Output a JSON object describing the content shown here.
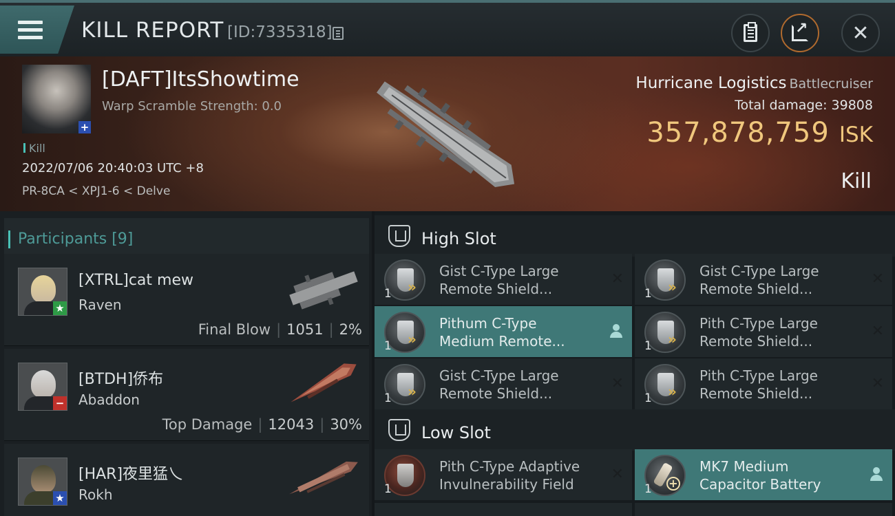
{
  "header": {
    "title": "KILL REPORT",
    "report_id": "[ID:7335318]",
    "menu_icon": "hamburger-menu-icon",
    "buttons": [
      "clipboard-icon",
      "share-icon",
      "close-icon"
    ]
  },
  "victim": {
    "name": "[DAFT]ItsShowtime",
    "warp_scramble": "Warp Scramble Strength: 0.0",
    "tag": "Kill",
    "datetime": "2022/07/06 20:40:03 UTC +8",
    "location": "PR-8CA < XPJ1-6 < Delve",
    "badge": "+"
  },
  "ship": {
    "name": "Hurricane Logistics",
    "class": "Battlecruiser",
    "total_damage_label": "Total damage:",
    "total_damage": "39808",
    "isk_value": "357,878,759",
    "isk_unit": "ISK",
    "result": "Kill"
  },
  "participants": {
    "title": "Participants [9]",
    "rows": [
      {
        "name": "[XTRL]cat mew",
        "ship": "Raven",
        "label": "Final Blow",
        "damage": "1051",
        "percent": "2%",
        "badge": "★",
        "badge_color": "#2e9a46"
      },
      {
        "name": "[BTDH]侨布",
        "ship": "Abaddon",
        "label": "Top Damage",
        "damage": "12043",
        "percent": "30%",
        "badge": "−",
        "badge_color": "#c0312b"
      },
      {
        "name": "[HAR]夜里猛乀",
        "ship": "Rokh",
        "label": "",
        "damage": "",
        "percent": "",
        "badge": "★",
        "badge_color": "#2b4fb0"
      }
    ]
  },
  "fitting": {
    "high_slot_title": "High Slot",
    "low_slot_title": "Low Slot",
    "high_slot": [
      {
        "line1": "Gist C-Type Large",
        "line2": "Remote Shield...",
        "qty": "1",
        "active": false
      },
      {
        "line1": "Gist C-Type Large",
        "line2": "Remote Shield...",
        "qty": "1",
        "active": false
      },
      {
        "line1": "Pithum C-Type",
        "line2": "Medium Remote...",
        "qty": "1",
        "active": true
      },
      {
        "line1": "Pith C-Type Large",
        "line2": "Remote Shield...",
        "qty": "1",
        "active": false
      },
      {
        "line1": "Gist C-Type Large",
        "line2": "Remote Shield...",
        "qty": "1",
        "active": false
      },
      {
        "line1": "Pith C-Type Large",
        "line2": "Remote Shield...",
        "qty": "1",
        "active": false
      }
    ],
    "low_slot": [
      {
        "line1": "Pith C-Type Adaptive",
        "line2": "Invulnerability Field",
        "qty": "1",
        "active": false
      },
      {
        "line1": "MK7 Medium",
        "line2": "Capacitor Battery",
        "qty": "1",
        "active": true
      }
    ]
  }
}
